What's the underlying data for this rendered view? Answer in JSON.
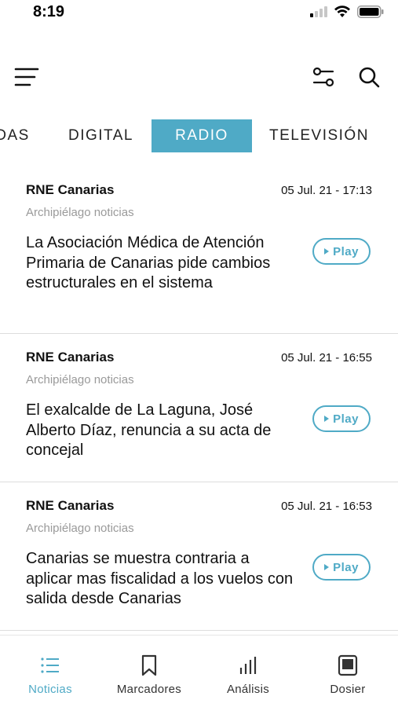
{
  "status_bar": {
    "time": "8:19"
  },
  "tabs": [
    {
      "label": "ODAS"
    },
    {
      "label": "DIGITAL"
    },
    {
      "label": "RADIO",
      "active": true
    },
    {
      "label": "TELEVISIÓN"
    }
  ],
  "news": [
    {
      "source": "RNE Canarias",
      "datetime": "05 Jul. 21 - 17:13",
      "program": "Archipiélago noticias",
      "headline": "La Asociación Médica de Atención Primaria de Canarias pide cambios estructurales en el sistema",
      "play_label": "Play"
    },
    {
      "source": "RNE Canarias",
      "datetime": "05 Jul. 21 - 16:55",
      "program": "Archipiélago noticias",
      "headline": "El exalcalde de La Laguna, José Alberto Díaz, renuncia a su acta de concejal",
      "play_label": "Play"
    },
    {
      "source": "RNE Canarias",
      "datetime": "05 Jul. 21 - 16:53",
      "program": "Archipiélago noticias",
      "headline": "Canarias se muestra contraria a aplicar mas fiscalidad a los vuelos con salida desde Canarias",
      "play_label": "Play"
    }
  ],
  "bottom_nav": [
    {
      "label": "Noticias",
      "icon": "list-icon",
      "active": true
    },
    {
      "label": "Marcadores",
      "icon": "bookmark-icon"
    },
    {
      "label": "Análisis",
      "icon": "bar-chart-icon"
    },
    {
      "label": "Dosier",
      "icon": "dossier-icon"
    }
  ],
  "colors": {
    "accent": "#4faac6",
    "text": "#111111",
    "muted": "#9a9a9a",
    "divider": "#dddddd"
  }
}
